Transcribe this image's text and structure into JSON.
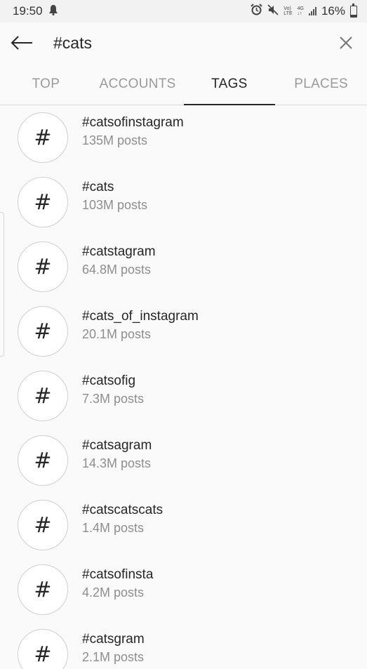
{
  "status_bar": {
    "time": "19:50",
    "network_top": "Vo)",
    "network_bottom": "LTE",
    "data_top": "4G",
    "data_bottom": "↓↑",
    "battery": "16%"
  },
  "search": {
    "value": "#cats"
  },
  "tabs": [
    {
      "label": "TOP",
      "active": false
    },
    {
      "label": "ACCOUNTS",
      "active": false
    },
    {
      "label": "TAGS",
      "active": true
    },
    {
      "label": "PLACES",
      "active": false
    }
  ],
  "hashtag_symbol": "#",
  "results": [
    {
      "tag": "#catsofinstagram",
      "count": "135M posts"
    },
    {
      "tag": "#cats",
      "count": "103M posts"
    },
    {
      "tag": "#catstagram",
      "count": "64.8M posts"
    },
    {
      "tag": "#cats_of_instagram",
      "count": "20.1M posts"
    },
    {
      "tag": "#catsofig",
      "count": "7.3M posts"
    },
    {
      "tag": "#catsagram",
      "count": "14.3M posts"
    },
    {
      "tag": "#catscatscats",
      "count": "1.4M posts"
    },
    {
      "tag": "#catsofinsta",
      "count": "4.2M posts"
    },
    {
      "tag": "#catsgram",
      "count": "2.1M posts"
    }
  ]
}
